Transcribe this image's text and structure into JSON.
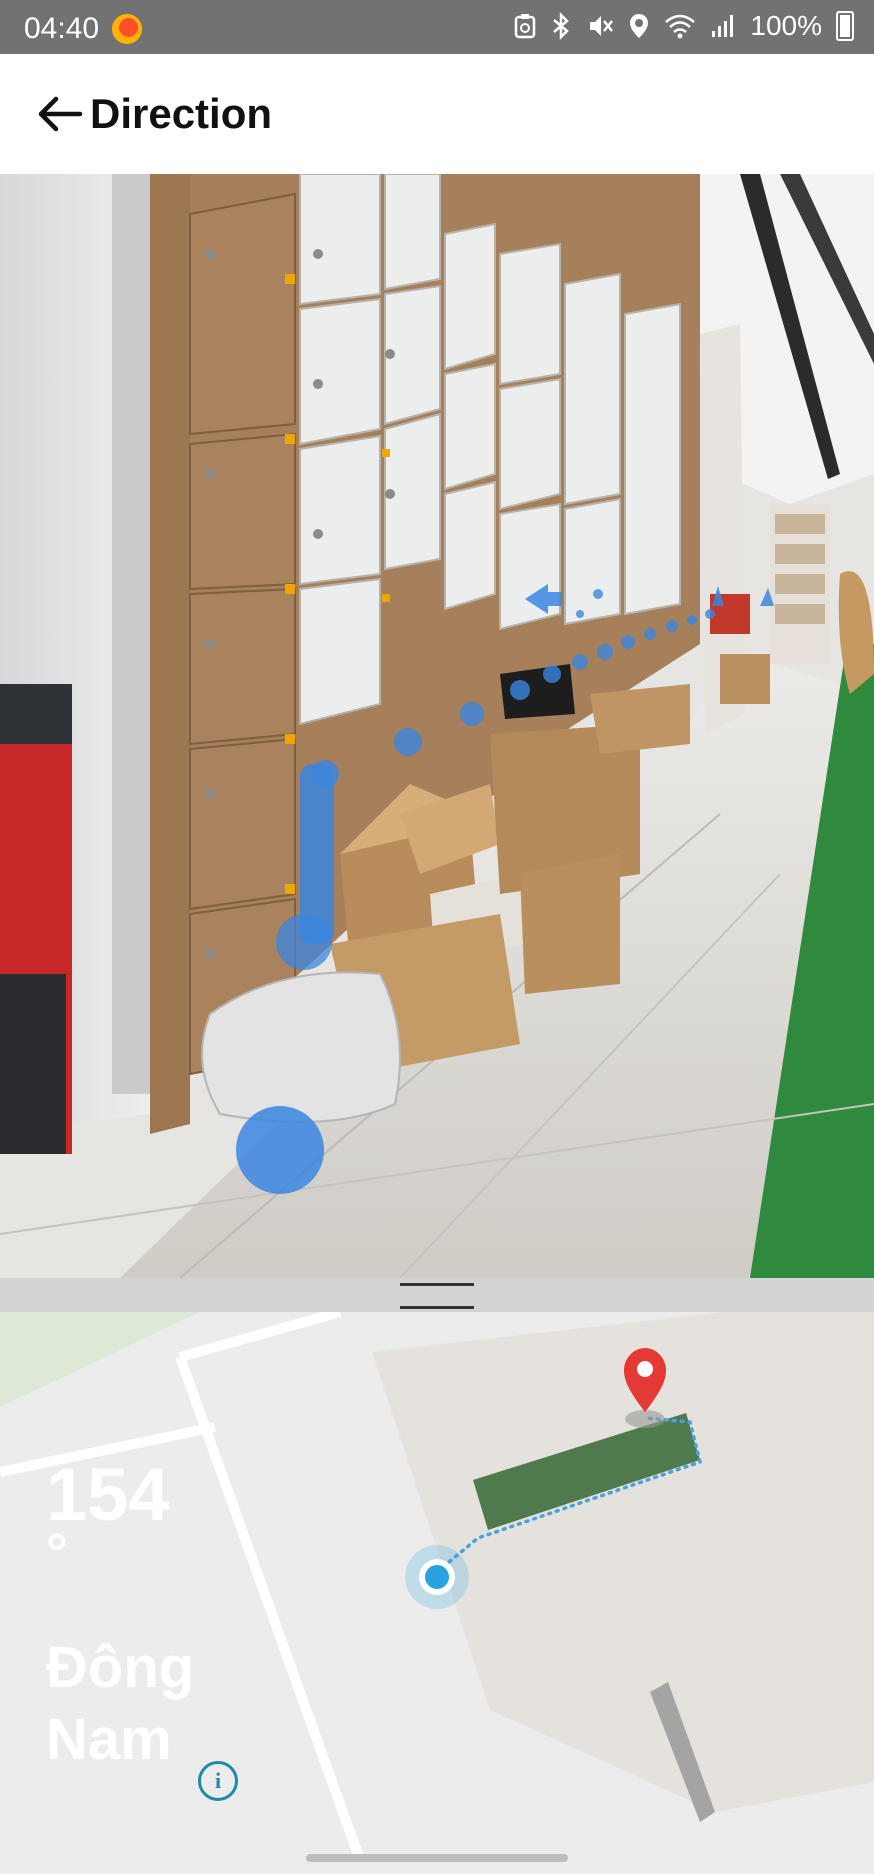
{
  "status_bar": {
    "time": "04:40",
    "battery": "100%",
    "icons": [
      "screenshot-icon",
      "bluetooth-icon",
      "mute-icon",
      "location-icon",
      "wifi-icon",
      "signal-icon",
      "battery-icon"
    ]
  },
  "app_bar": {
    "title": "Direction",
    "back_icon": "arrow-left-icon"
  },
  "camera_view": {
    "description_icon": "ar-path-overlay",
    "colors": {
      "path": "#3a86e0",
      "floor": "#d8d6d1",
      "carpet": "#2e8a3c",
      "lockers_white": "#e9eaeb",
      "lockers_wood": "#a27c57"
    }
  },
  "map": {
    "heading_value": "154",
    "heading_degree": "°",
    "heading_direction": "Đông Nam",
    "info_icon": "info-icon",
    "colors": {
      "building": "#e5e2de",
      "target": "#4e7a4e",
      "route": "#4aa3dc",
      "pin": "#e53935",
      "user": "#29a3e0",
      "park": "#dde8d6"
    }
  }
}
